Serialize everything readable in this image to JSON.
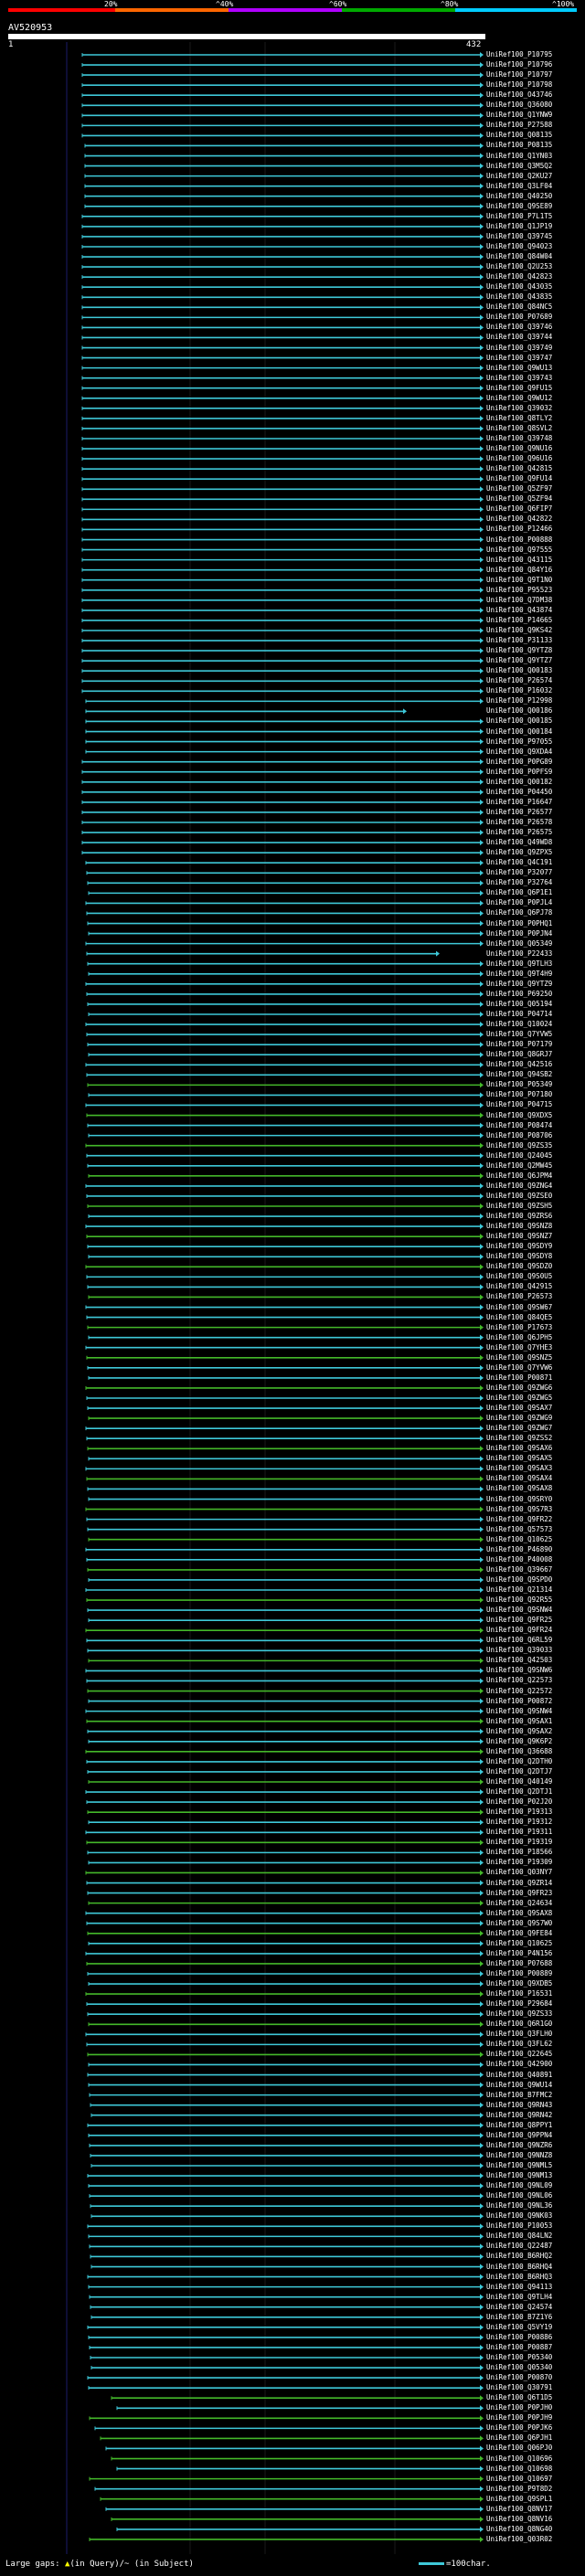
{
  "legend": {
    "ticks": [
      "20%",
      "^40%",
      "^60%",
      "^80%",
      "^100%"
    ],
    "colors": [
      "#ff0000",
      "#ff6600",
      "#b000ff",
      "#00aa00",
      "#00ccff"
    ]
  },
  "query": {
    "id": "AV520953",
    "start": "1",
    "end": "432"
  },
  "hits": [
    "UniRef100_P10795",
    "UniRef100_P10796",
    "UniRef100_P10797",
    "UniRef100_P10798",
    "UniRef100_O43746",
    "UniRef100_Q36080",
    "UniRef100_Q1YNW9",
    "UniRef100_P27588",
    "UniRef100_Q08135",
    "UniRef100_P08135",
    "UniRef100_Q1YN03",
    "UniRef100_Q3M5Q2",
    "UniRef100_Q2KU27",
    "UniRef100_Q3LF04",
    "UniRef100_Q40250",
    "UniRef100_Q9SE89",
    "UniRef100_P7L1T5",
    "UniRef100_Q1JP19",
    "UniRef100_Q39745",
    "UniRef100_Q94023",
    "UniRef100_Q84W04",
    "UniRef100_Q2U253",
    "UniRef100_Q42823",
    "UniRef100_Q43035",
    "UniRef100_Q43835",
    "UniRef100_Q84NC5",
    "UniRef100_P07689",
    "UniRef100_Q39746",
    "UniRef100_Q39744",
    "UniRef100_Q39749",
    "UniRef100_Q39747",
    "UniRef100_Q9WU13",
    "UniRef100_Q39743",
    "UniRef100_Q9FU15",
    "UniRef100_Q9WU12",
    "UniRef100_Q39032",
    "UniRef100_Q8TLY2",
    "UniRef100_Q8SVL2",
    "UniRef100_Q39748",
    "UniRef100_Q9NU16",
    "UniRef100_Q96U16",
    "UniRef100_Q42815",
    "UniRef100_Q9FU14",
    "UniRef100_Q5ZF97",
    "UniRef100_Q5ZF94",
    "UniRef100_Q6FIP7",
    "UniRef100_Q42822",
    "UniRef100_P12466",
    "UniRef100_P00888",
    "UniRef100_Q97555",
    "UniRef100_Q43115",
    "UniRef100_Q84Y16",
    "UniRef100_Q9T1N0",
    "UniRef100_P95523",
    "UniRef100_Q7DM38",
    "UniRef100_Q43874",
    "UniRef100_P14665",
    "UniRef100_Q9KS42",
    "UniRef100_P31133",
    "UniRef100_Q9YTZ8",
    "UniRef100_Q9YTZ7",
    "UniRef100_Q00183",
    "UniRef100_P26574",
    "UniRef100_P16032",
    "UniRef100_P12998",
    "UniRef100_Q00186",
    "UniRef100_Q00185",
    "UniRef100_Q00184",
    "UniRef100_P97055",
    "UniRef100_Q9XDA4",
    "UniRef100_P0PG89",
    "UniRef100_P0PFS9",
    "UniRef100_Q00182",
    "UniRef100_P04450",
    "UniRef100_P16647",
    "UniRef100_P26577",
    "UniRef100_P26578",
    "UniRef100_P26575",
    "UniRef100_Q49WD8",
    "UniRef100_Q9ZPX5",
    "UniRef100_Q4C191",
    "UniRef100_P32077",
    "UniRef100_P32764",
    "UniRef100_Q6P1E1",
    "UniRef100_P0PJL4",
    "UniRef100_Q6PJ78",
    "UniRef100_P0PHQ1",
    "UniRef100_P0PJN4",
    "UniRef100_Q05349",
    "UniRef100_P22433",
    "UniRef100_Q9TLH3",
    "UniRef100_Q9T4H9",
    "UniRef100_Q9YTZ9",
    "UniRef100_P69250",
    "UniRef100_Q05194",
    "UniRef100_P04714",
    "UniRef100_Q10024",
    "UniRef100_Q7YVW5",
    "UniRef100_P07179",
    "UniRef100_Q8GRJ7",
    "UniRef100_Q42516",
    "UniRef100_Q94SB2",
    "UniRef100_P05349",
    "UniRef100_P07180",
    "UniRef100_P04715",
    "UniRef100_Q9XDX5",
    "UniRef100_P08474",
    "UniRef100_P08706",
    "UniRef100_Q9ZS35",
    "UniRef100_Q24045",
    "UniRef100_Q2MW45",
    "UniRef100_Q6JPM4",
    "UniRef100_Q9ZNG4",
    "UniRef100_Q9ZSE0",
    "UniRef100_Q9ZSH5",
    "UniRef100_Q9ZRS6",
    "UniRef100_Q9SNZ8",
    "UniRef100_Q9SNZ7",
    "UniRef100_Q9SDY9",
    "UniRef100_Q9SDY8",
    "UniRef100_Q9SDZ0",
    "UniRef100_Q9S0U5",
    "UniRef100_Q42915",
    "UniRef100_P26573",
    "UniRef100_Q9SW67",
    "UniRef100_Q84QE5",
    "UniRef100_P17673",
    "UniRef100_Q6JPH5",
    "UniRef100_Q7YHE3",
    "UniRef100_Q9SNZ5",
    "UniRef100_Q7YVW6",
    "UniRef100_P00871",
    "UniRef100_Q9ZWG6",
    "UniRef100_Q9ZWG5",
    "UniRef100_Q9SAX7",
    "UniRef100_Q9ZWG9",
    "UniRef100_Q9ZWG7",
    "UniRef100_Q9ZSS2",
    "UniRef100_Q9SAX6",
    "UniRef100_Q9SAX5",
    "UniRef100_Q9SAX3",
    "UniRef100_Q9SAX4",
    "UniRef100_Q9SAX8",
    "UniRef100_Q9SRY0",
    "UniRef100_Q9S7R3",
    "UniRef100_Q9FR22",
    "UniRef100_Q57573",
    "UniRef100_Q10625",
    "UniRef100_P46890",
    "UniRef100_P40008",
    "UniRef100_Q39667",
    "UniRef100_Q9SPD0",
    "UniRef100_Q21314",
    "UniRef100_Q92R55",
    "UniRef100_Q9SNW4",
    "UniRef100_Q9FR25",
    "UniRef100_Q9FR24",
    "UniRef100_Q6RL59",
    "UniRef100_Q39033",
    "UniRef100_Q42503",
    "UniRef100_Q9SNW6",
    "UniRef100_Q22573",
    "UniRef100_Q22572",
    "UniRef100_P00872",
    "UniRef100_Q9SNW4",
    "UniRef100_Q9SAX1",
    "UniRef100_Q9SAX2",
    "UniRef100_Q9K6P2",
    "UniRef100_Q36688",
    "UniRef100_Q2DTH0",
    "UniRef100_Q2DTJ7",
    "UniRef100_Q40149",
    "UniRef100_Q2DTJ1",
    "UniRef100_P02J20",
    "UniRef100_P19313",
    "UniRef100_P19312",
    "UniRef100_P19311",
    "UniRef100_P19319",
    "UniRef100_P18566",
    "UniRef100_P19309",
    "UniRef100_Q03NY7",
    "UniRef100_Q9ZR14",
    "UniRef100_Q9FR23",
    "UniRef100_Q24634",
    "UniRef100_Q9SAX8",
    "UniRef100_Q9S7W0",
    "UniRef100_Q9FE84",
    "UniRef100_Q10625",
    "UniRef100_P4N156",
    "UniRef100_P07688",
    "UniRef100_P00889",
    "UniRef100_Q9XDB5",
    "UniRef100_P16531",
    "UniRef100_P29684",
    "UniRef100_Q9ZS33",
    "UniRef100_Q6R1G0",
    "UniRef100_Q3FLH0",
    "UniRef100_Q3FL62",
    "UniRef100_Q22645",
    "UniRef100_Q42900",
    "UniRef100_Q40891",
    "UniRef100_Q9WU14",
    "UniRef100_B7FMC2",
    "UniRef100_Q9RN43",
    "UniRef100_Q9RN42",
    "UniRef100_Q8PPY1",
    "UniRef100_Q9PPN4",
    "UniRef100_Q9NZR6",
    "UniRef100_Q9NNZ8",
    "UniRef100_Q9NML5",
    "UniRef100_Q9NM13",
    "UniRef100_Q9NL09",
    "UniRef100_Q9NL06",
    "UniRef100_Q9NL36",
    "UniRef100_Q9NK03",
    "UniRef100_P10053",
    "UniRef100_Q84LN2",
    "UniRef100_Q22487",
    "UniRef100_B6RHQ2",
    "UniRef100_B6RHQ4",
    "UniRef100_B6RHQ3",
    "UniRef100_Q94113",
    "UniRef100_Q9TLH4",
    "UniRef100_Q24574",
    "UniRef100_B7Z1Y6",
    "UniRef100_Q5VY19",
    "UniRef100_P00886",
    "UniRef100_P00887",
    "UniRef100_P05340",
    "UniRef100_Q05340",
    "UniRef100_P00870",
    "UniRef100_Q30791",
    "UniRef100_Q6T1D5",
    "UniRef100_P0PJH0",
    "UniRef100_P0PJH9",
    "UniRef100_P0PJK6",
    "UniRef100_Q6PJH1",
    "UniRef100_Q06PJ0",
    "UniRef100_Q10696",
    "UniRef100_Q10698",
    "UniRef100_Q10697",
    "UniRef100_P9T8D2",
    "UniRef100_Q9SPL1",
    "UniRef100_Q8NV17",
    "UniRef100_Q8NV16",
    "UniRef100_Q8NG40",
    "UniRef100_Q03R02"
  ],
  "footer": {
    "gaps_label": "Large gaps:",
    "query_gap": "(in Query)",
    "subject_gap": "/~ (in Subject)",
    "scale_label": "=100char."
  }
}
